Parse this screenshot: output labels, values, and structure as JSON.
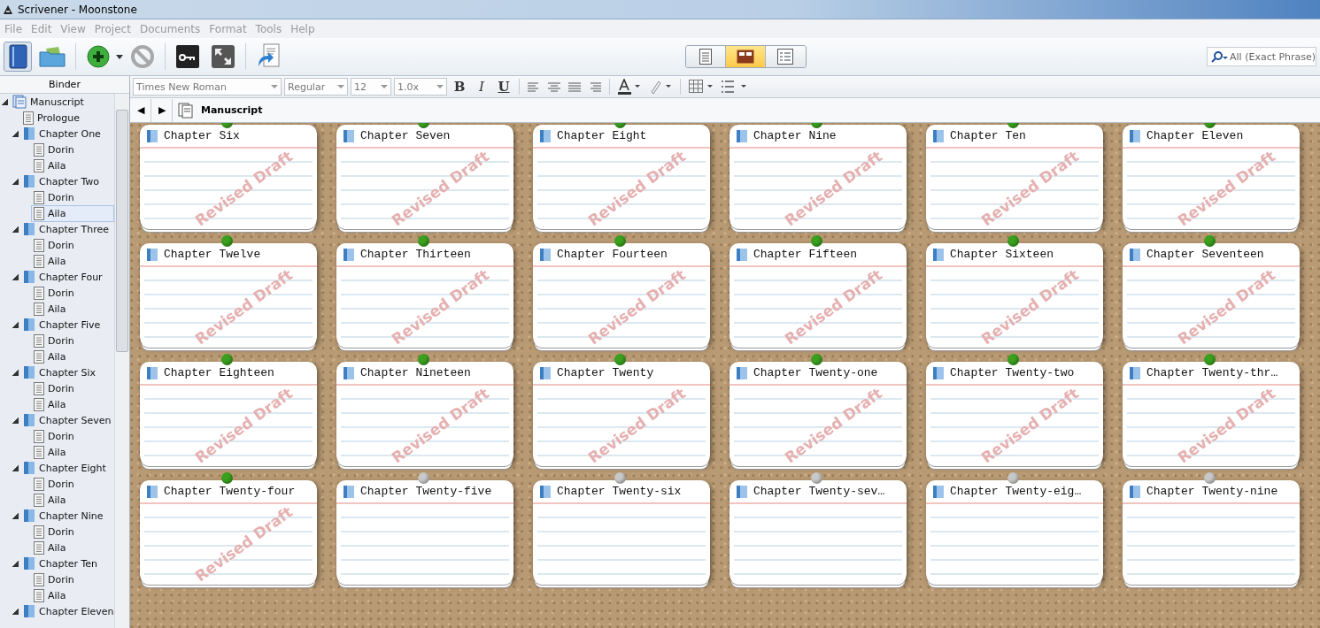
{
  "window": {
    "title": "Scrivener - Moonstone"
  },
  "menu": [
    "File",
    "Edit",
    "View",
    "Project",
    "Documents",
    "Format",
    "Tools",
    "Help"
  ],
  "view_modes": [
    {
      "kind": "scrivenings",
      "selected": false
    },
    {
      "kind": "corkboard",
      "selected": true
    },
    {
      "kind": "outliner",
      "selected": false
    }
  ],
  "search": {
    "placeholder": "All (Exact Phrase)"
  },
  "binder": {
    "title": "Binder",
    "items": [
      {
        "label": "Manuscript",
        "kind": "root",
        "expanded": true,
        "selected": false,
        "children": [
          {
            "label": "Prologue",
            "kind": "document",
            "selected": false
          },
          {
            "label": "Chapter One",
            "kind": "folder",
            "expanded": true,
            "selected": false,
            "children": [
              {
                "label": "Dorin",
                "kind": "document",
                "selected": false
              },
              {
                "label": "Aila",
                "kind": "document",
                "selected": false
              }
            ]
          },
          {
            "label": "Chapter Two",
            "kind": "folder",
            "expanded": true,
            "selected": false,
            "children": [
              {
                "label": "Dorin",
                "kind": "document",
                "selected": false
              },
              {
                "label": "Aila",
                "kind": "document",
                "selected": true
              }
            ]
          },
          {
            "label": "Chapter Three",
            "kind": "folder",
            "expanded": true,
            "selected": false,
            "children": [
              {
                "label": "Dorin",
                "kind": "document",
                "selected": false
              },
              {
                "label": "Aila",
                "kind": "document",
                "selected": false
              }
            ]
          },
          {
            "label": "Chapter Four",
            "kind": "folder",
            "expanded": true,
            "selected": false,
            "children": [
              {
                "label": "Dorin",
                "kind": "document",
                "selected": false
              },
              {
                "label": "Aila",
                "kind": "document",
                "selected": false
              }
            ]
          },
          {
            "label": "Chapter Five",
            "kind": "folder",
            "expanded": true,
            "selected": false,
            "children": [
              {
                "label": "Dorin",
                "kind": "document",
                "selected": false
              },
              {
                "label": "Aila",
                "kind": "document",
                "selected": false
              }
            ]
          },
          {
            "label": "Chapter Six",
            "kind": "folder",
            "expanded": true,
            "selected": false,
            "children": [
              {
                "label": "Dorin",
                "kind": "document",
                "selected": false
              },
              {
                "label": "Aila",
                "kind": "document",
                "selected": false
              }
            ]
          },
          {
            "label": "Chapter Seven",
            "kind": "folder",
            "expanded": true,
            "selected": false,
            "children": [
              {
                "label": "Dorin",
                "kind": "document",
                "selected": false
              },
              {
                "label": "Aila",
                "kind": "document",
                "selected": false
              }
            ]
          },
          {
            "label": "Chapter Eight",
            "kind": "folder",
            "expanded": true,
            "selected": false,
            "children": [
              {
                "label": "Dorin",
                "kind": "document",
                "selected": false
              },
              {
                "label": "Aila",
                "kind": "document",
                "selected": false
              }
            ]
          },
          {
            "label": "Chapter Nine",
            "kind": "folder",
            "expanded": true,
            "selected": false,
            "children": [
              {
                "label": "Dorin",
                "kind": "document",
                "selected": false
              },
              {
                "label": "Aila",
                "kind": "document",
                "selected": false
              }
            ]
          },
          {
            "label": "Chapter Ten",
            "kind": "folder",
            "expanded": true,
            "selected": false,
            "children": [
              {
                "label": "Dorin",
                "kind": "document",
                "selected": false
              },
              {
                "label": "Aila",
                "kind": "document",
                "selected": false
              }
            ]
          },
          {
            "label": "Chapter Eleven",
            "kind": "folder",
            "expanded": true,
            "selected": false
          }
        ]
      }
    ]
  },
  "format_bar": {
    "font": "Times New Roman",
    "style": "Regular",
    "size": "12",
    "spacing": "1.0x",
    "bold": "B",
    "italic": "I",
    "underline": "U"
  },
  "header": {
    "back": "◀",
    "forward": "▶",
    "title": "Manuscript"
  },
  "cards": [
    {
      "title": "Chapter Six",
      "color": "#3aa01e",
      "stamp": "Revised Draft"
    },
    {
      "title": "Chapter Seven",
      "color": "#3aa01e",
      "stamp": "Revised Draft"
    },
    {
      "title": "Chapter Eight",
      "color": "#3aa01e",
      "stamp": "Revised Draft"
    },
    {
      "title": "Chapter Nine",
      "color": "#3aa01e",
      "stamp": "Revised Draft"
    },
    {
      "title": "Chapter Ten",
      "color": "#3aa01e",
      "stamp": "Revised Draft"
    },
    {
      "title": "Chapter Eleven",
      "color": "#3aa01e",
      "stamp": "Revised Draft"
    },
    {
      "title": "Chapter Twelve",
      "color": "#3aa01e",
      "stamp": "Revised Draft"
    },
    {
      "title": "Chapter Thirteen",
      "color": "#3aa01e",
      "stamp": "Revised Draft"
    },
    {
      "title": "Chapter Fourteen",
      "color": "#3aa01e",
      "stamp": "Revised Draft"
    },
    {
      "title": "Chapter Fifteen",
      "color": "#3aa01e",
      "stamp": "Revised Draft"
    },
    {
      "title": "Chapter Sixteen",
      "color": "#3aa01e",
      "stamp": "Revised Draft"
    },
    {
      "title": "Chapter Seventeen",
      "color": "#3aa01e",
      "stamp": "Revised Draft"
    },
    {
      "title": "Chapter Eighteen",
      "color": "#3aa01e",
      "stamp": "Revised Draft"
    },
    {
      "title": "Chapter Nineteen",
      "color": "#3aa01e",
      "stamp": "Revised Draft"
    },
    {
      "title": "Chapter Twenty",
      "color": "#3aa01e",
      "stamp": "Revised Draft"
    },
    {
      "title": "Chapter Twenty-one",
      "color": "#3aa01e",
      "stamp": "Revised Draft"
    },
    {
      "title": "Chapter Twenty-two",
      "color": "#3aa01e",
      "stamp": "Revised Draft"
    },
    {
      "title": "Chapter Twenty-thr…",
      "color": "#3aa01e",
      "stamp": "Revised Draft"
    },
    {
      "title": "Chapter Twenty-four",
      "color": "#3aa01e",
      "stamp": "Revised Draft"
    },
    {
      "title": "Chapter Twenty-five",
      "color": "#c8c8c8"
    },
    {
      "title": "Chapter Twenty-six",
      "color": "#c8c8c8"
    },
    {
      "title": "Chapter Twenty-sev…",
      "color": "#c8c8c8"
    },
    {
      "title": "Chapter Twenty-eig…",
      "color": "#c8c8c8"
    },
    {
      "title": "Chapter Twenty-nine",
      "color": "#c8c8c8"
    }
  ]
}
